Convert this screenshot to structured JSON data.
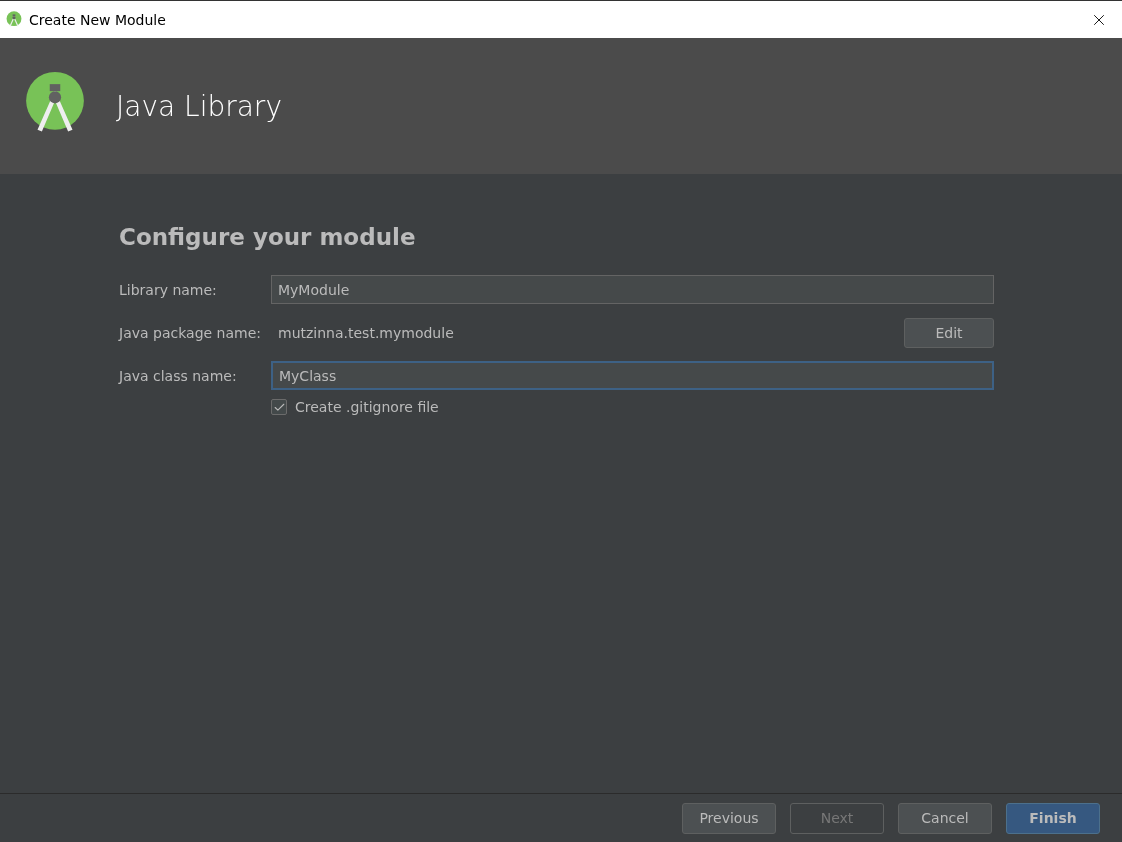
{
  "window": {
    "title": "Create New Module"
  },
  "header": {
    "title": "Java Library"
  },
  "form": {
    "heading": "Configure your module",
    "rows": [
      {
        "kind": "input",
        "label": "Library name:",
        "value": "MyModule",
        "focused": false
      },
      {
        "kind": "text",
        "label": "Java package name:",
        "value": "mutzinna.test.mymodule",
        "button": "Edit"
      },
      {
        "kind": "input",
        "label": "Java class name:",
        "value": "MyClass",
        "focused": true
      }
    ],
    "checkbox": {
      "label": "Create .gitignore file",
      "checked": true
    }
  },
  "buttons": [
    {
      "label": "Previous",
      "disabled": false,
      "default": false
    },
    {
      "label": "Next",
      "disabled": true,
      "default": false
    },
    {
      "label": "Cancel",
      "disabled": false,
      "default": false
    },
    {
      "label": "Finish",
      "disabled": false,
      "default": true
    }
  ]
}
